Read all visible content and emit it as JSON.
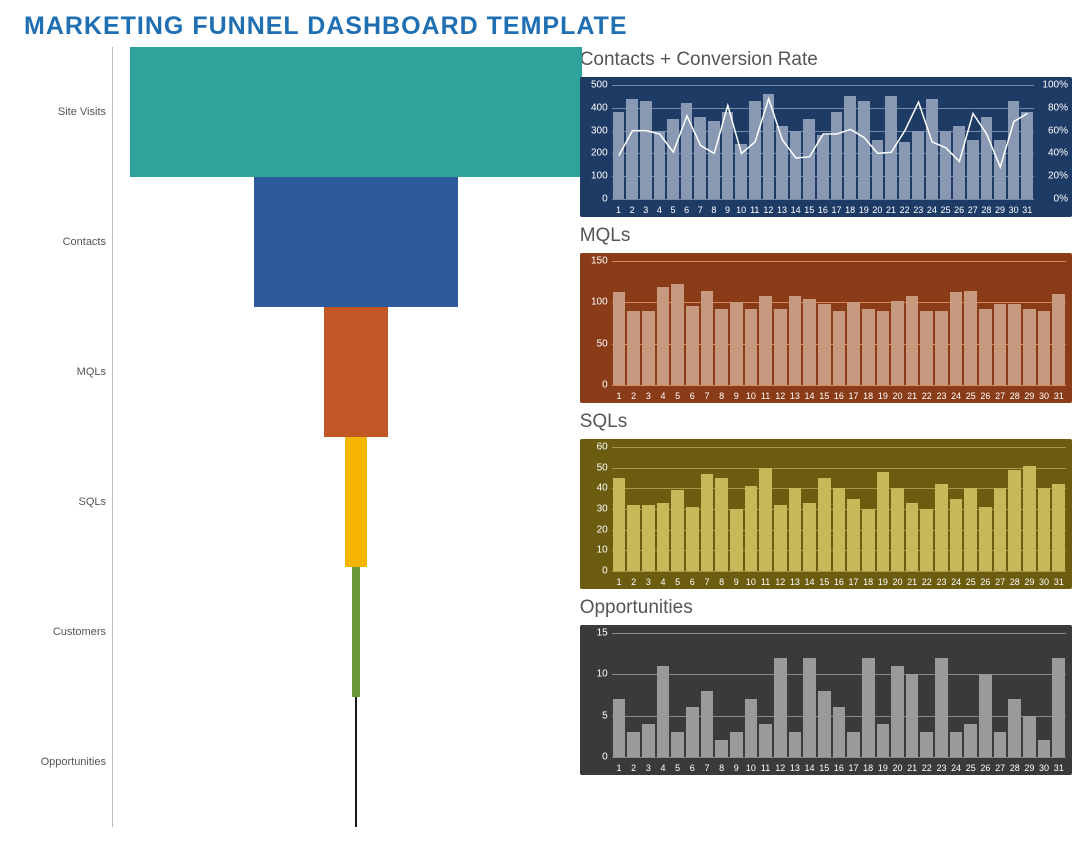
{
  "title": "MARKETING FUNNEL DASHBOARD TEMPLATE",
  "funnel": {
    "stages": [
      {
        "label": "Site Visits",
        "color": "#2fa39b"
      },
      {
        "label": "Contacts",
        "color": "#2c5a9a"
      },
      {
        "label": "MQLs",
        "color": "#c15627"
      },
      {
        "label": "SQLs",
        "color": "#f5b400"
      },
      {
        "label": "Customers",
        "color": "#6a9a3b"
      },
      {
        "label": "Opportunities",
        "color": "#1a1a1a"
      }
    ]
  },
  "cards": {
    "contacts": {
      "title": "Contacts + Conversion Rate"
    },
    "mqls": {
      "title": "MQLs"
    },
    "sqls": {
      "title": "SQLs"
    },
    "opps": {
      "title": "Opportunities"
    }
  },
  "chart_data": [
    {
      "id": "funnel",
      "type": "bar",
      "orientation": "horizontal-centered",
      "categories": [
        "Site Visits",
        "Contacts",
        "MQLs",
        "SQLs",
        "Customers",
        "Opportunities"
      ],
      "values": [
        1000,
        450,
        140,
        50,
        18,
        2
      ],
      "colors": [
        "#2fa39b",
        "#2c5a9a",
        "#c15627",
        "#f5b400",
        "#6a9a3b",
        "#1a1a1a"
      ],
      "note": "widths scale linearly; center aligned at x≈332 of 452px plot width"
    },
    {
      "id": "contacts_conversion",
      "type": "combo",
      "title": "Contacts + Conversion Rate",
      "x": [
        1,
        2,
        3,
        4,
        5,
        6,
        7,
        8,
        9,
        10,
        11,
        12,
        13,
        14,
        15,
        16,
        17,
        18,
        19,
        20,
        21,
        22,
        23,
        24,
        25,
        26,
        27,
        28,
        29,
        30,
        31
      ],
      "series": [
        {
          "name": "Contacts",
          "type": "bar",
          "yaxis": "left",
          "values": [
            380,
            440,
            430,
            300,
            350,
            420,
            360,
            340,
            380,
            240,
            430,
            460,
            320,
            300,
            350,
            280,
            380,
            450,
            430,
            260,
            450,
            250,
            300,
            440,
            300,
            320,
            260,
            360,
            260,
            430,
            380
          ]
        },
        {
          "name": "Conversion Rate",
          "type": "line",
          "yaxis": "right",
          "values": [
            38,
            60,
            60,
            57,
            41,
            73,
            47,
            40,
            82,
            40,
            50,
            88,
            52,
            36,
            37,
            57,
            57,
            61,
            54,
            40,
            41,
            60,
            85,
            50,
            45,
            33,
            75,
            57,
            28,
            68,
            75
          ]
        }
      ],
      "y_left": {
        "label": "",
        "ticks": [
          0,
          100,
          200,
          300,
          400,
          500
        ],
        "range": [
          0,
          500
        ]
      },
      "y_right": {
        "label": "",
        "ticks": [
          "0%",
          "20%",
          "40%",
          "60%",
          "80%",
          "100%"
        ],
        "range": [
          0,
          100
        ]
      },
      "bg": "#1e3b66",
      "bar_color": "#8a99b3",
      "line_color": "#ffffff",
      "grid": true
    },
    {
      "id": "mqls",
      "type": "bar",
      "title": "MQLs",
      "x": [
        1,
        2,
        3,
        4,
        5,
        6,
        7,
        8,
        9,
        10,
        11,
        12,
        13,
        14,
        15,
        16,
        17,
        18,
        19,
        20,
        21,
        22,
        23,
        24,
        25,
        26,
        27,
        28,
        29,
        30,
        31
      ],
      "values": [
        112,
        90,
        90,
        118,
        122,
        95,
        114,
        92,
        100,
        92,
        108,
        92,
        108,
        104,
        98,
        90,
        100,
        92,
        90,
        102,
        108,
        90,
        90,
        112,
        114,
        92,
        98,
        98,
        92,
        90,
        110
      ],
      "y": {
        "ticks": [
          0,
          50,
          100,
          150
        ],
        "range": [
          0,
          150
        ]
      },
      "bg": "#8a3c18",
      "bar_color": "#c79a80",
      "grid_color": "#d48a54"
    },
    {
      "id": "sqls",
      "type": "bar",
      "title": "SQLs",
      "x": [
        1,
        2,
        3,
        4,
        5,
        6,
        7,
        8,
        9,
        10,
        11,
        12,
        13,
        14,
        15,
        16,
        17,
        18,
        19,
        20,
        21,
        22,
        23,
        24,
        25,
        26,
        27,
        28,
        29,
        30,
        31
      ],
      "values": [
        45,
        32,
        32,
        33,
        39,
        31,
        47,
        45,
        30,
        41,
        50,
        32,
        40,
        33,
        45,
        40,
        35,
        30,
        48,
        40,
        33,
        30,
        42,
        35,
        40,
        31,
        40,
        49,
        51,
        40,
        42
      ],
      "y": {
        "ticks": [
          0,
          10,
          20,
          30,
          40,
          50,
          60
        ],
        "range": [
          0,
          60
        ]
      },
      "bg": "#6b5c10",
      "bar_color": "#c8b85a",
      "grid_color": "#a8984a"
    },
    {
      "id": "opportunities",
      "type": "bar",
      "title": "Opportunities",
      "x": [
        1,
        2,
        3,
        4,
        5,
        6,
        7,
        8,
        9,
        10,
        11,
        12,
        13,
        14,
        15,
        16,
        17,
        18,
        19,
        20,
        21,
        22,
        23,
        24,
        25,
        26,
        27,
        28,
        29,
        30,
        31
      ],
      "values": [
        7,
        3,
        4,
        11,
        3,
        6,
        8,
        2,
        3,
        7,
        4,
        12,
        3,
        12,
        8,
        6,
        3,
        12,
        4,
        11,
        10,
        3,
        12,
        3,
        4,
        10,
        3,
        7,
        5,
        2,
        12
      ],
      "y": {
        "ticks": [
          0,
          5,
          10,
          15
        ],
        "range": [
          0,
          15
        ]
      },
      "bg": "#3a3a3a",
      "bar_color": "#9a9a9a",
      "grid_color": "#8a8a8a"
    }
  ]
}
